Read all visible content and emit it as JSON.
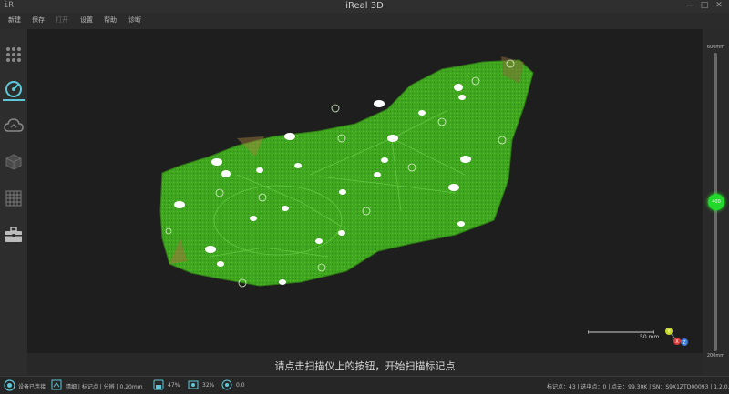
{
  "titlebar": {
    "logo": "iR",
    "title": "iReal 3D",
    "minimize": "—",
    "maximize": "□",
    "close": "✕"
  },
  "menu": [
    "新建",
    "保存",
    "打开",
    "设置",
    "帮助",
    "诊断"
  ],
  "viewport": {
    "scale_label": "50 mm",
    "axes": {
      "y": "Y",
      "x": "X",
      "z": "Z"
    }
  },
  "prompt": "请点击扫描仪上的按钮，开始扫描标记点",
  "slider": {
    "top_label": "600mm",
    "bottom_label": "200mm",
    "value_label": "400",
    "value_fraction": 0.5
  },
  "status": {
    "device": "设备已连接",
    "mode_info": "精细 | 标记点 | 分辨 | 0.20mm",
    "storage": "47%",
    "frame": "32%",
    "exposure": "0.0",
    "right_info": "标记点：43 | 选中点：0 | 点云：99.30K | SN：S9X1ZTD00093 | 1.2.0.14"
  },
  "colors": {
    "accent": "#5ec8d8",
    "mesh": "#3fa61f",
    "slider_handle": "#22d82a"
  }
}
